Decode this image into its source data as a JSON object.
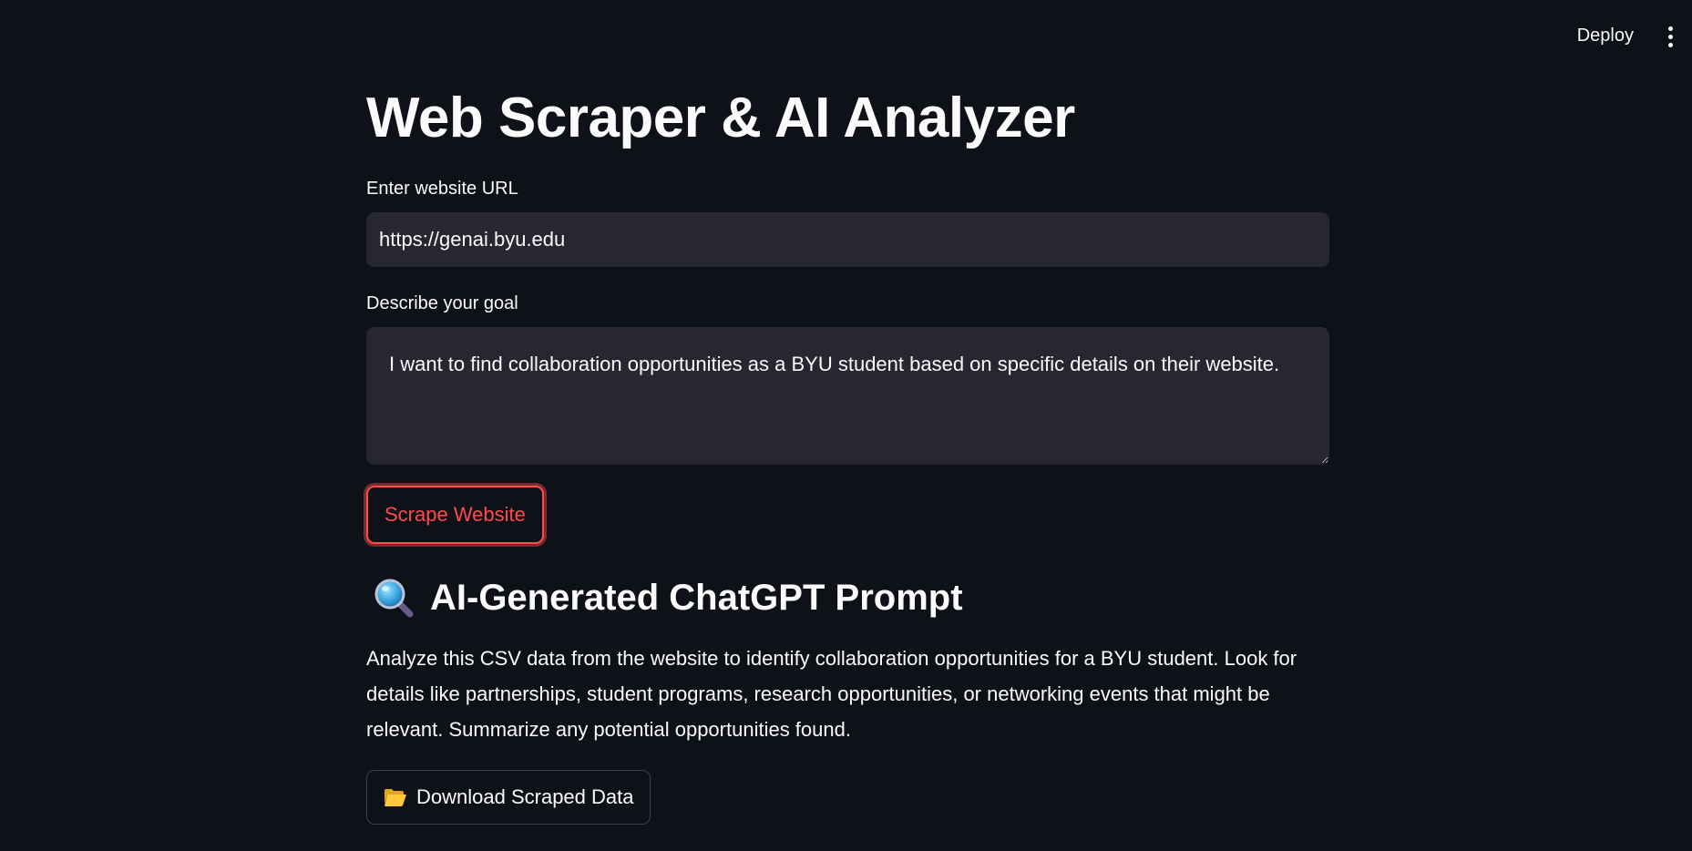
{
  "header": {
    "deploy_label": "Deploy",
    "menu_icon": "vertical-ellipsis-icon"
  },
  "main": {
    "title": "Web Scraper & AI Analyzer",
    "url_field": {
      "label": "Enter website URL",
      "value": "https://genai.byu.edu"
    },
    "goal_field": {
      "label": "Describe your goal",
      "value": "I want to find collaboration opportunities as a BYU student based on specific details on their website."
    },
    "scrape_button_label": "Scrape Website",
    "prompt_section": {
      "icon": "magnifying-glass-icon",
      "heading": "AI-Generated ChatGPT Prompt",
      "text": "Analyze this CSV data from the website to identify collaboration opportunities for a BYU student. Look for details like partnerships, student programs, research opportunities, or networking events that might be relevant. Summarize any potential opportunities found."
    },
    "download_button": {
      "icon": "folder-icon",
      "label": "Download Scraped Data"
    }
  },
  "colors": {
    "background": "#0e1117",
    "input_background": "#262730",
    "accent": "#ff4b4b",
    "text": "#fafafa"
  }
}
